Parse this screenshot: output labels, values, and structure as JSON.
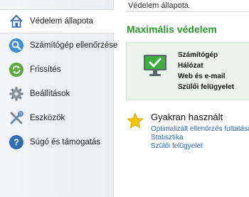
{
  "sidebar": {
    "items": [
      {
        "label": "Védelem állapota",
        "icon": "home-icon"
      },
      {
        "label": "Számítógép ellenőrzése",
        "icon": "search-icon"
      },
      {
        "label": "Frissítés",
        "icon": "refresh-icon"
      },
      {
        "label": "Beállítások",
        "icon": "gear-icon"
      },
      {
        "label": "Eszközök",
        "icon": "tools-icon"
      },
      {
        "label": "Súgó és támogatás",
        "icon": "help-icon"
      }
    ]
  },
  "main": {
    "breadcrumb": "Védelem állapota",
    "title": "Maximális védelem",
    "status": {
      "icon": "monitor-check-icon",
      "items": [
        "Számítógép",
        "Hálózat",
        "Web és e-mail",
        "Szülői felügyelet"
      ]
    },
    "frequent": {
      "icon": "star-icon",
      "title": "Gyakran használt",
      "links": [
        "Optimalizált ellenőrzés futtatása",
        "Statisztika",
        "Szülői felügyelet"
      ]
    }
  },
  "colors": {
    "accent_green": "#2d9a2d",
    "link_blue": "#2a6bb0",
    "status_bg": "#eaf3ec"
  }
}
